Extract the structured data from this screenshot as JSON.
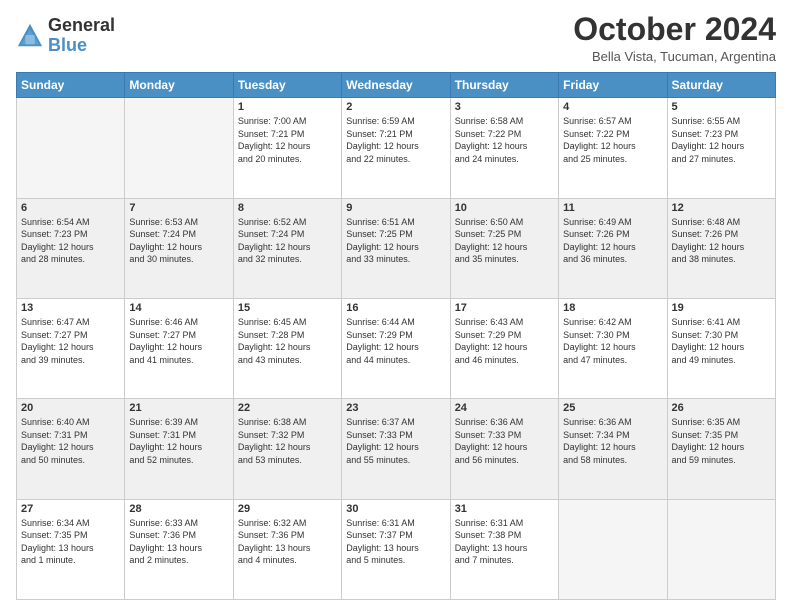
{
  "header": {
    "logo_general": "General",
    "logo_blue": "Blue",
    "month_title": "October 2024",
    "subtitle": "Bella Vista, Tucuman, Argentina"
  },
  "days_of_week": [
    "Sunday",
    "Monday",
    "Tuesday",
    "Wednesday",
    "Thursday",
    "Friday",
    "Saturday"
  ],
  "weeks": [
    [
      {
        "day": "",
        "info": ""
      },
      {
        "day": "",
        "info": ""
      },
      {
        "day": "1",
        "info": "Sunrise: 7:00 AM\nSunset: 7:21 PM\nDaylight: 12 hours\nand 20 minutes."
      },
      {
        "day": "2",
        "info": "Sunrise: 6:59 AM\nSunset: 7:21 PM\nDaylight: 12 hours\nand 22 minutes."
      },
      {
        "day": "3",
        "info": "Sunrise: 6:58 AM\nSunset: 7:22 PM\nDaylight: 12 hours\nand 24 minutes."
      },
      {
        "day": "4",
        "info": "Sunrise: 6:57 AM\nSunset: 7:22 PM\nDaylight: 12 hours\nand 25 minutes."
      },
      {
        "day": "5",
        "info": "Sunrise: 6:55 AM\nSunset: 7:23 PM\nDaylight: 12 hours\nand 27 minutes."
      }
    ],
    [
      {
        "day": "6",
        "info": "Sunrise: 6:54 AM\nSunset: 7:23 PM\nDaylight: 12 hours\nand 28 minutes."
      },
      {
        "day": "7",
        "info": "Sunrise: 6:53 AM\nSunset: 7:24 PM\nDaylight: 12 hours\nand 30 minutes."
      },
      {
        "day": "8",
        "info": "Sunrise: 6:52 AM\nSunset: 7:24 PM\nDaylight: 12 hours\nand 32 minutes."
      },
      {
        "day": "9",
        "info": "Sunrise: 6:51 AM\nSunset: 7:25 PM\nDaylight: 12 hours\nand 33 minutes."
      },
      {
        "day": "10",
        "info": "Sunrise: 6:50 AM\nSunset: 7:25 PM\nDaylight: 12 hours\nand 35 minutes."
      },
      {
        "day": "11",
        "info": "Sunrise: 6:49 AM\nSunset: 7:26 PM\nDaylight: 12 hours\nand 36 minutes."
      },
      {
        "day": "12",
        "info": "Sunrise: 6:48 AM\nSunset: 7:26 PM\nDaylight: 12 hours\nand 38 minutes."
      }
    ],
    [
      {
        "day": "13",
        "info": "Sunrise: 6:47 AM\nSunset: 7:27 PM\nDaylight: 12 hours\nand 39 minutes."
      },
      {
        "day": "14",
        "info": "Sunrise: 6:46 AM\nSunset: 7:27 PM\nDaylight: 12 hours\nand 41 minutes."
      },
      {
        "day": "15",
        "info": "Sunrise: 6:45 AM\nSunset: 7:28 PM\nDaylight: 12 hours\nand 43 minutes."
      },
      {
        "day": "16",
        "info": "Sunrise: 6:44 AM\nSunset: 7:29 PM\nDaylight: 12 hours\nand 44 minutes."
      },
      {
        "day": "17",
        "info": "Sunrise: 6:43 AM\nSunset: 7:29 PM\nDaylight: 12 hours\nand 46 minutes."
      },
      {
        "day": "18",
        "info": "Sunrise: 6:42 AM\nSunset: 7:30 PM\nDaylight: 12 hours\nand 47 minutes."
      },
      {
        "day": "19",
        "info": "Sunrise: 6:41 AM\nSunset: 7:30 PM\nDaylight: 12 hours\nand 49 minutes."
      }
    ],
    [
      {
        "day": "20",
        "info": "Sunrise: 6:40 AM\nSunset: 7:31 PM\nDaylight: 12 hours\nand 50 minutes."
      },
      {
        "day": "21",
        "info": "Sunrise: 6:39 AM\nSunset: 7:31 PM\nDaylight: 12 hours\nand 52 minutes."
      },
      {
        "day": "22",
        "info": "Sunrise: 6:38 AM\nSunset: 7:32 PM\nDaylight: 12 hours\nand 53 minutes."
      },
      {
        "day": "23",
        "info": "Sunrise: 6:37 AM\nSunset: 7:33 PM\nDaylight: 12 hours\nand 55 minutes."
      },
      {
        "day": "24",
        "info": "Sunrise: 6:36 AM\nSunset: 7:33 PM\nDaylight: 12 hours\nand 56 minutes."
      },
      {
        "day": "25",
        "info": "Sunrise: 6:36 AM\nSunset: 7:34 PM\nDaylight: 12 hours\nand 58 minutes."
      },
      {
        "day": "26",
        "info": "Sunrise: 6:35 AM\nSunset: 7:35 PM\nDaylight: 12 hours\nand 59 minutes."
      }
    ],
    [
      {
        "day": "27",
        "info": "Sunrise: 6:34 AM\nSunset: 7:35 PM\nDaylight: 13 hours\nand 1 minute."
      },
      {
        "day": "28",
        "info": "Sunrise: 6:33 AM\nSunset: 7:36 PM\nDaylight: 13 hours\nand 2 minutes."
      },
      {
        "day": "29",
        "info": "Sunrise: 6:32 AM\nSunset: 7:36 PM\nDaylight: 13 hours\nand 4 minutes."
      },
      {
        "day": "30",
        "info": "Sunrise: 6:31 AM\nSunset: 7:37 PM\nDaylight: 13 hours\nand 5 minutes."
      },
      {
        "day": "31",
        "info": "Sunrise: 6:31 AM\nSunset: 7:38 PM\nDaylight: 13 hours\nand 7 minutes."
      },
      {
        "day": "",
        "info": ""
      },
      {
        "day": "",
        "info": ""
      }
    ]
  ]
}
